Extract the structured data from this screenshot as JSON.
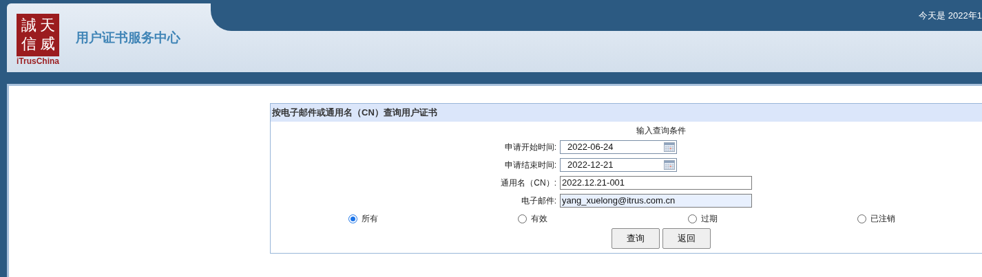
{
  "header": {
    "logo": {
      "chars": [
        "誠",
        "天",
        "信",
        "威"
      ],
      "brand": "iTrusChina"
    },
    "title": "用户证书服务中心",
    "date_text": "今天是 2022年1"
  },
  "panel": {
    "title": "按电子邮件或通用名（CN）查询用户证书",
    "subtitle": "输入查询条件",
    "fields": [
      {
        "kind": "date",
        "label": "申请开始时间:",
        "value": "2022-06-24",
        "highlighted": false
      },
      {
        "kind": "date",
        "label": "申请结束时间:",
        "value": "2022-12-21",
        "highlighted": false
      },
      {
        "kind": "text",
        "label": "通用名（CN）:",
        "value": "2022.12.21-001",
        "highlighted": false
      },
      {
        "kind": "text",
        "label": "电子邮件:",
        "value": "yang_xuelong@itrus.com.cn",
        "highlighted": true
      }
    ],
    "status_options": [
      {
        "label": "所有",
        "selected": true
      },
      {
        "label": "有效",
        "selected": false
      },
      {
        "label": "过期",
        "selected": false
      },
      {
        "label": "已注销",
        "selected": false
      }
    ],
    "buttons": [
      "查询",
      "返回"
    ]
  }
}
